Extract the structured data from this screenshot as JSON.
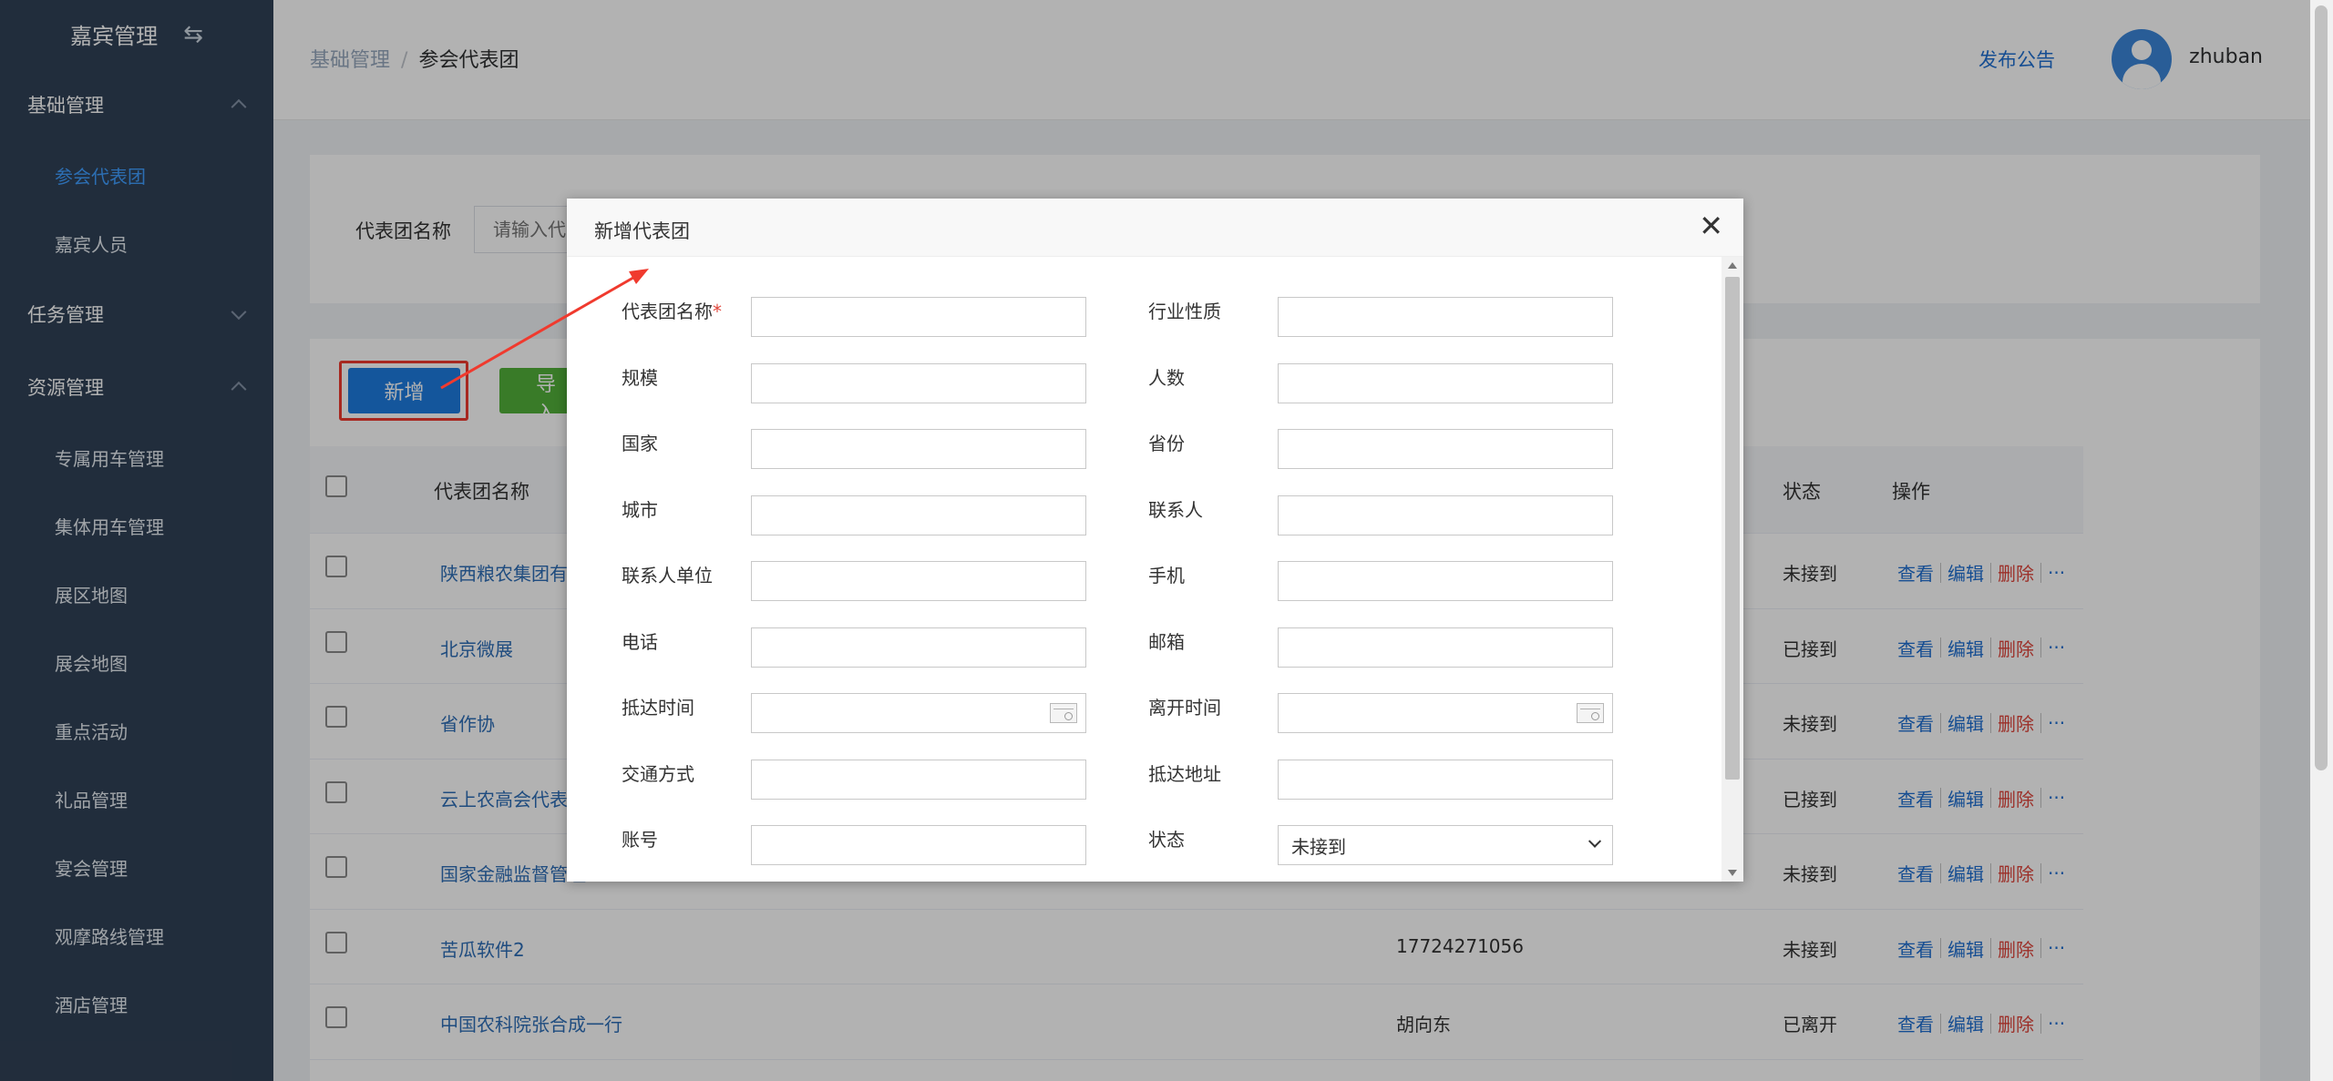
{
  "sidebar": {
    "title": "嘉宾管理",
    "toggle_icon": "switch-arrows-icon",
    "groups": [
      {
        "label": "基础管理",
        "expanded": true,
        "items": [
          "参会代表团",
          "嘉宾人员"
        ]
      },
      {
        "label": "任务管理",
        "expanded": false,
        "items": []
      },
      {
        "label": "资源管理",
        "expanded": true,
        "items": [
          "专属用车管理",
          "集体用车管理",
          "展区地图",
          "展会地图",
          "重点活动",
          "礼品管理",
          "宴会管理",
          "观摩路线管理",
          "酒店管理"
        ]
      }
    ],
    "active_item": "参会代表团"
  },
  "header": {
    "breadcrumb": [
      "基础管理",
      "参会代表团"
    ],
    "breadcrumb_sep": "/",
    "notice_link": "发布公告",
    "username": "zhuban"
  },
  "search": {
    "label": "代表团名称",
    "placeholder": "请输入代"
  },
  "toolbar": {
    "add_label": "新增",
    "import_label": "导入"
  },
  "table": {
    "columns": {
      "name": "代表团名称",
      "status": "状态",
      "ops": "操作"
    },
    "rows": [
      {
        "name": "陕西粮农集团有限",
        "contact": "",
        "status": "未接到"
      },
      {
        "name": "北京微展",
        "contact": "",
        "status": "已接到"
      },
      {
        "name": "省作协",
        "contact": "",
        "status": "未接到"
      },
      {
        "name": "云上农高会代表团",
        "contact": "",
        "status": "已接到"
      },
      {
        "name": "国家金融监督管理",
        "contact": "",
        "status": "未接到"
      },
      {
        "name": "苦瓜软件2",
        "contact": "17724271056",
        "status": "未接到"
      },
      {
        "name": "中国农科院张合成一行",
        "contact": "胡向东",
        "status": "已离开"
      }
    ],
    "op_view": "查看",
    "op_edit": "编辑",
    "op_delete": "删除",
    "op_more": "···"
  },
  "dialog": {
    "title": "新增代表团",
    "close_icon": "close-icon",
    "fields": {
      "delegation_name": "代表团名称",
      "required_mark": "*",
      "industry": "行业性质",
      "scale": "规模",
      "headcount": "人数",
      "country": "国家",
      "province": "省份",
      "city": "城市",
      "contact_person": "联系人",
      "contact_org": "联系人单位",
      "mobile": "手机",
      "phone": "电话",
      "email": "邮箱",
      "arrival_time": "抵达时间",
      "departure_time": "离开时间",
      "transport": "交通方式",
      "arrival_address": "抵达地址",
      "account": "账号",
      "status": "状态"
    },
    "status_value": "未接到"
  },
  "colors": {
    "sidebar_bg": "#304156",
    "active_menu": "#409eff",
    "add_button": "#1e7be0",
    "import_button": "#52b13a",
    "annotation": "#f03a2e",
    "link": "#1f6fd1",
    "delete": "#e0463c"
  }
}
